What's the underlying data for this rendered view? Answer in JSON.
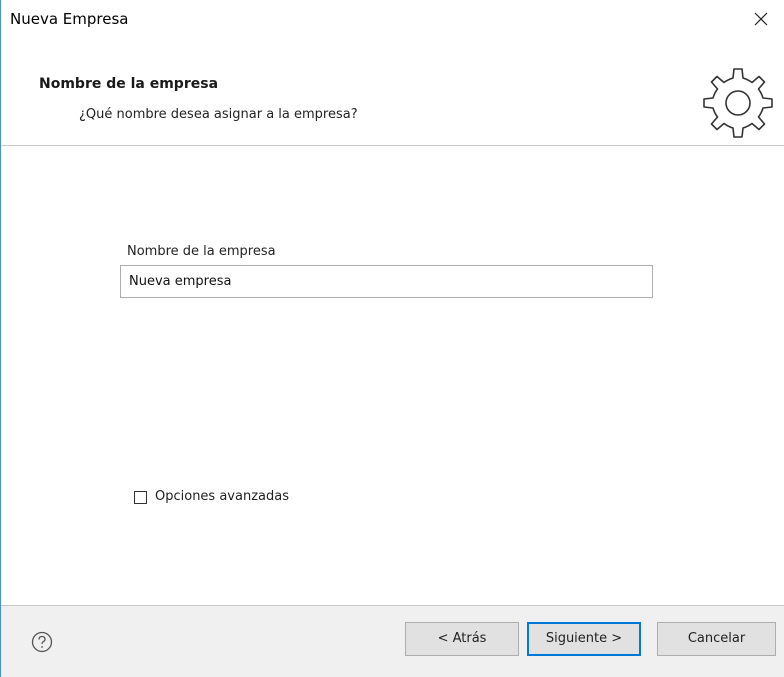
{
  "window": {
    "title": "Nueva Empresa"
  },
  "header": {
    "title": "Nombre de la empresa",
    "subtitle": "¿Qué nombre desea asignar a la empresa?",
    "icon": "gear-icon"
  },
  "form": {
    "company_name_label": "Nombre de la empresa",
    "company_name_value": "Nueva empresa",
    "advanced_options_label": "Opciones avanzadas",
    "advanced_options_checked": false
  },
  "footer": {
    "help_icon": "help-icon",
    "back_label": "< Atrás",
    "next_label": "Siguiente >",
    "cancel_label": "Cancelar"
  },
  "colors": {
    "window_border": "#4a90d9",
    "footer_bg": "#f0f0f0",
    "default_button_border": "#0078d7"
  }
}
